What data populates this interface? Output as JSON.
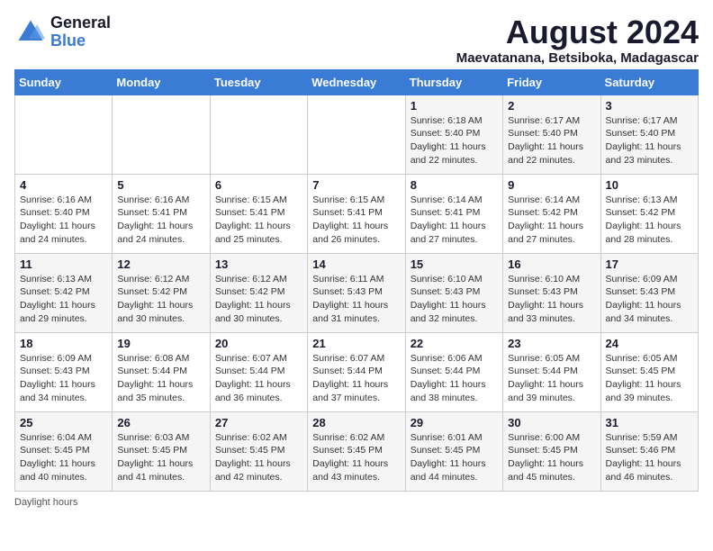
{
  "logo": {
    "text_general": "General",
    "text_blue": "Blue"
  },
  "title": "August 2024",
  "subtitle": "Maevatanana, Betsiboka, Madagascar",
  "days_of_week": [
    "Sunday",
    "Monday",
    "Tuesday",
    "Wednesday",
    "Thursday",
    "Friday",
    "Saturday"
  ],
  "footer": "Daylight hours",
  "weeks": [
    [
      {
        "day": "",
        "info": ""
      },
      {
        "day": "",
        "info": ""
      },
      {
        "day": "",
        "info": ""
      },
      {
        "day": "",
        "info": ""
      },
      {
        "day": "1",
        "info": "Sunrise: 6:18 AM\nSunset: 5:40 PM\nDaylight: 11 hours and 22 minutes."
      },
      {
        "day": "2",
        "info": "Sunrise: 6:17 AM\nSunset: 5:40 PM\nDaylight: 11 hours and 22 minutes."
      },
      {
        "day": "3",
        "info": "Sunrise: 6:17 AM\nSunset: 5:40 PM\nDaylight: 11 hours and 23 minutes."
      }
    ],
    [
      {
        "day": "4",
        "info": "Sunrise: 6:16 AM\nSunset: 5:40 PM\nDaylight: 11 hours and 24 minutes."
      },
      {
        "day": "5",
        "info": "Sunrise: 6:16 AM\nSunset: 5:41 PM\nDaylight: 11 hours and 24 minutes."
      },
      {
        "day": "6",
        "info": "Sunrise: 6:15 AM\nSunset: 5:41 PM\nDaylight: 11 hours and 25 minutes."
      },
      {
        "day": "7",
        "info": "Sunrise: 6:15 AM\nSunset: 5:41 PM\nDaylight: 11 hours and 26 minutes."
      },
      {
        "day": "8",
        "info": "Sunrise: 6:14 AM\nSunset: 5:41 PM\nDaylight: 11 hours and 27 minutes."
      },
      {
        "day": "9",
        "info": "Sunrise: 6:14 AM\nSunset: 5:42 PM\nDaylight: 11 hours and 27 minutes."
      },
      {
        "day": "10",
        "info": "Sunrise: 6:13 AM\nSunset: 5:42 PM\nDaylight: 11 hours and 28 minutes."
      }
    ],
    [
      {
        "day": "11",
        "info": "Sunrise: 6:13 AM\nSunset: 5:42 PM\nDaylight: 11 hours and 29 minutes."
      },
      {
        "day": "12",
        "info": "Sunrise: 6:12 AM\nSunset: 5:42 PM\nDaylight: 11 hours and 30 minutes."
      },
      {
        "day": "13",
        "info": "Sunrise: 6:12 AM\nSunset: 5:42 PM\nDaylight: 11 hours and 30 minutes."
      },
      {
        "day": "14",
        "info": "Sunrise: 6:11 AM\nSunset: 5:43 PM\nDaylight: 11 hours and 31 minutes."
      },
      {
        "day": "15",
        "info": "Sunrise: 6:10 AM\nSunset: 5:43 PM\nDaylight: 11 hours and 32 minutes."
      },
      {
        "day": "16",
        "info": "Sunrise: 6:10 AM\nSunset: 5:43 PM\nDaylight: 11 hours and 33 minutes."
      },
      {
        "day": "17",
        "info": "Sunrise: 6:09 AM\nSunset: 5:43 PM\nDaylight: 11 hours and 34 minutes."
      }
    ],
    [
      {
        "day": "18",
        "info": "Sunrise: 6:09 AM\nSunset: 5:43 PM\nDaylight: 11 hours and 34 minutes."
      },
      {
        "day": "19",
        "info": "Sunrise: 6:08 AM\nSunset: 5:44 PM\nDaylight: 11 hours and 35 minutes."
      },
      {
        "day": "20",
        "info": "Sunrise: 6:07 AM\nSunset: 5:44 PM\nDaylight: 11 hours and 36 minutes."
      },
      {
        "day": "21",
        "info": "Sunrise: 6:07 AM\nSunset: 5:44 PM\nDaylight: 11 hours and 37 minutes."
      },
      {
        "day": "22",
        "info": "Sunrise: 6:06 AM\nSunset: 5:44 PM\nDaylight: 11 hours and 38 minutes."
      },
      {
        "day": "23",
        "info": "Sunrise: 6:05 AM\nSunset: 5:44 PM\nDaylight: 11 hours and 39 minutes."
      },
      {
        "day": "24",
        "info": "Sunrise: 6:05 AM\nSunset: 5:45 PM\nDaylight: 11 hours and 39 minutes."
      }
    ],
    [
      {
        "day": "25",
        "info": "Sunrise: 6:04 AM\nSunset: 5:45 PM\nDaylight: 11 hours and 40 minutes."
      },
      {
        "day": "26",
        "info": "Sunrise: 6:03 AM\nSunset: 5:45 PM\nDaylight: 11 hours and 41 minutes."
      },
      {
        "day": "27",
        "info": "Sunrise: 6:02 AM\nSunset: 5:45 PM\nDaylight: 11 hours and 42 minutes."
      },
      {
        "day": "28",
        "info": "Sunrise: 6:02 AM\nSunset: 5:45 PM\nDaylight: 11 hours and 43 minutes."
      },
      {
        "day": "29",
        "info": "Sunrise: 6:01 AM\nSunset: 5:45 PM\nDaylight: 11 hours and 44 minutes."
      },
      {
        "day": "30",
        "info": "Sunrise: 6:00 AM\nSunset: 5:45 PM\nDaylight: 11 hours and 45 minutes."
      },
      {
        "day": "31",
        "info": "Sunrise: 5:59 AM\nSunset: 5:46 PM\nDaylight: 11 hours and 46 minutes."
      }
    ]
  ]
}
